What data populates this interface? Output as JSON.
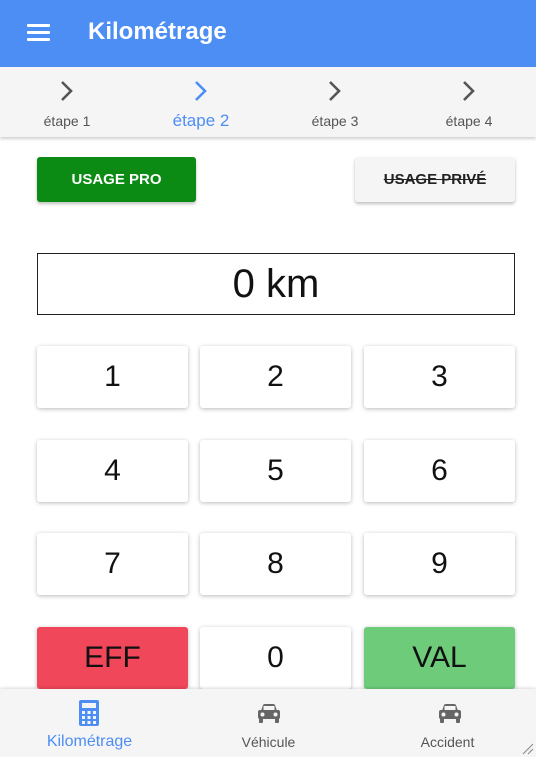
{
  "appbar": {
    "title": "Kilométrage",
    "menu_icon": "hamburger-menu-icon"
  },
  "stepper": {
    "steps": [
      {
        "label": "étape 1",
        "active": false
      },
      {
        "label": "étape 2",
        "active": true
      },
      {
        "label": "étape 3",
        "active": false
      },
      {
        "label": "étape 4",
        "active": false
      }
    ],
    "icon": "chevron-right-icon"
  },
  "usage": {
    "pro_label": "USAGE PRO",
    "prive_label": "USAGE PRIVÉ"
  },
  "display": {
    "value": "0 km"
  },
  "keypad": {
    "keys": [
      "1",
      "2",
      "3",
      "4",
      "5",
      "6",
      "7",
      "8",
      "9",
      "EFF",
      "0",
      "VAL"
    ]
  },
  "bottom_nav": {
    "items": [
      {
        "label": "Kilométrage",
        "icon": "calculator-icon",
        "active": true
      },
      {
        "label": "Véhicule",
        "icon": "car-icon",
        "active": false
      },
      {
        "label": "Accident",
        "icon": "car-icon",
        "active": false
      }
    ]
  },
  "colors": {
    "primary": "#4d8ef5",
    "pro_green": "#0b8a14",
    "eff_red": "#f0475a",
    "val_green": "#6dcb7a"
  }
}
